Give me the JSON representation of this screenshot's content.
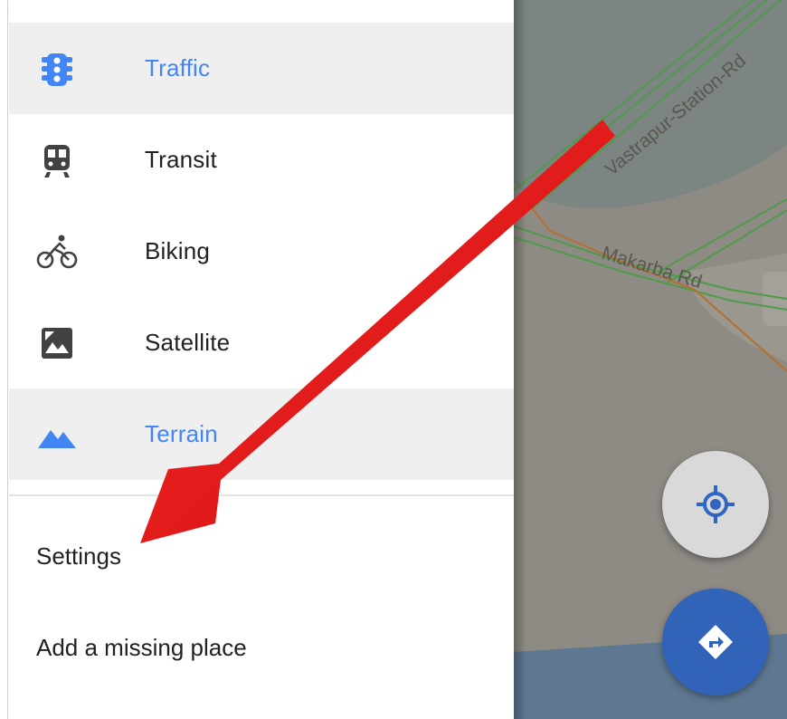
{
  "layers": [
    {
      "id": "traffic",
      "label": "Traffic",
      "icon": "traffic-light-icon",
      "active": true
    },
    {
      "id": "transit",
      "label": "Transit",
      "icon": "train-icon",
      "active": false
    },
    {
      "id": "biking",
      "label": "Biking",
      "icon": "bicycle-icon",
      "active": false
    },
    {
      "id": "satellite",
      "label": "Satellite",
      "icon": "satellite-image-icon",
      "active": false
    },
    {
      "id": "terrain",
      "label": "Terrain",
      "icon": "mountain-icon",
      "active": true
    }
  ],
  "menu": {
    "settings_label": "Settings",
    "add_place_label": "Add a missing place"
  },
  "map": {
    "road_labels": [
      "Vastrapur-Station-Rd",
      "Makarba Rd"
    ],
    "buttons": [
      "my-location-icon",
      "directions-icon"
    ]
  },
  "colors": {
    "accent": "#4285f4",
    "active_row_bg": "#efefef",
    "text": "#212121",
    "arrow": "#e01414",
    "directions_fab": "#3164b8",
    "location_fab": "#d9d9d9"
  }
}
